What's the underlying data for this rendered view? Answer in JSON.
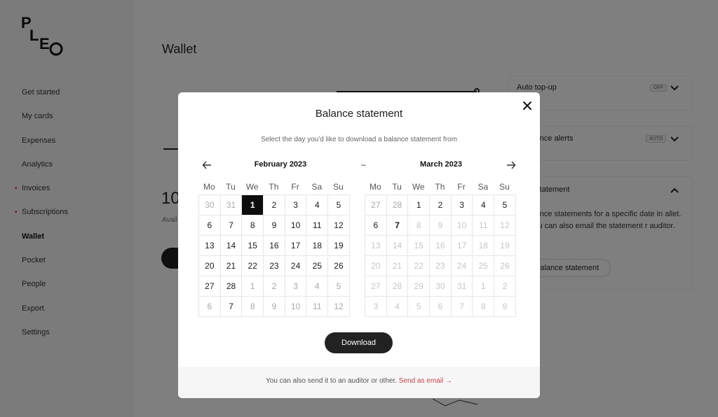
{
  "sidebar": {
    "logo_text": "PLEO",
    "items": [
      {
        "label": "Get started",
        "dot": false,
        "active": false
      },
      {
        "label": "My cards",
        "dot": false,
        "active": false
      },
      {
        "label": "Expenses",
        "dot": false,
        "active": false
      },
      {
        "label": "Analytics",
        "dot": false,
        "active": false
      },
      {
        "label": "Invoices",
        "dot": true,
        "active": false
      },
      {
        "label": "Subscriptions",
        "dot": true,
        "active": false
      },
      {
        "label": "Wallet",
        "dot": false,
        "active": true
      },
      {
        "label": "Pocket",
        "dot": false,
        "active": false
      },
      {
        "label": "People",
        "dot": false,
        "active": false
      },
      {
        "label": "Export",
        "dot": false,
        "active": false
      },
      {
        "label": "Settings",
        "dot": false,
        "active": false
      }
    ]
  },
  "main": {
    "title": "Wallet",
    "balance_partial": "10",
    "available_partial": "Avail"
  },
  "right_panel": {
    "auto_topup": {
      "label": "Auto top-up",
      "badge": "OFF"
    },
    "alerts": {
      "label": "alance alerts",
      "badge": "AUTO"
    },
    "statement": {
      "label": "e statement",
      "text": "alance statements for a specific date in allet. You can also email the statement r auditor.",
      "button": "et balance statement"
    }
  },
  "modal": {
    "title": "Balance statement",
    "subtitle": "Select the day you'd like to download a balance statement from",
    "range_separator": "–",
    "weekdays": [
      "Mo",
      "Tu",
      "We",
      "Th",
      "Fr",
      "Sa",
      "Su"
    ],
    "months": [
      {
        "title": "February 2023",
        "days": [
          [
            "30",
            "muted"
          ],
          [
            "31",
            "muted"
          ],
          [
            "1",
            "selected"
          ],
          [
            "2",
            ""
          ],
          [
            "3",
            ""
          ],
          [
            "4",
            ""
          ],
          [
            "5",
            ""
          ],
          [
            "6",
            ""
          ],
          [
            "7",
            ""
          ],
          [
            "8",
            ""
          ],
          [
            "9",
            ""
          ],
          [
            "10",
            ""
          ],
          [
            "11",
            ""
          ],
          [
            "12",
            ""
          ],
          [
            "13",
            ""
          ],
          [
            "14",
            ""
          ],
          [
            "15",
            ""
          ],
          [
            "16",
            ""
          ],
          [
            "17",
            ""
          ],
          [
            "18",
            ""
          ],
          [
            "19",
            ""
          ],
          [
            "20",
            ""
          ],
          [
            "21",
            ""
          ],
          [
            "22",
            ""
          ],
          [
            "23",
            ""
          ],
          [
            "24",
            ""
          ],
          [
            "25",
            ""
          ],
          [
            "26",
            ""
          ],
          [
            "27",
            ""
          ],
          [
            "28",
            ""
          ],
          [
            "1",
            "muted"
          ],
          [
            "2",
            "muted"
          ],
          [
            "3",
            "muted"
          ],
          [
            "4",
            "muted"
          ],
          [
            "5",
            "muted"
          ],
          [
            "6",
            "muted"
          ],
          [
            "7",
            ""
          ],
          [
            "8",
            "muted"
          ],
          [
            "9",
            "muted"
          ],
          [
            "10",
            "muted"
          ],
          [
            "11",
            "muted"
          ],
          [
            "12",
            "muted"
          ]
        ]
      },
      {
        "title": "March 2023",
        "days": [
          [
            "27",
            "muted"
          ],
          [
            "28",
            "muted"
          ],
          [
            "1",
            ""
          ],
          [
            "2",
            ""
          ],
          [
            "3",
            ""
          ],
          [
            "4",
            ""
          ],
          [
            "5",
            ""
          ],
          [
            "6",
            ""
          ],
          [
            "7",
            "strong"
          ],
          [
            "8",
            "disabled"
          ],
          [
            "9",
            "disabled"
          ],
          [
            "10",
            "disabled"
          ],
          [
            "11",
            "disabled"
          ],
          [
            "12",
            "disabled"
          ],
          [
            "13",
            "disabled"
          ],
          [
            "14",
            "disabled"
          ],
          [
            "15",
            "disabled"
          ],
          [
            "16",
            "disabled"
          ],
          [
            "17",
            "disabled"
          ],
          [
            "18",
            "disabled"
          ],
          [
            "19",
            "disabled"
          ],
          [
            "20",
            "disabled"
          ],
          [
            "21",
            "disabled"
          ],
          [
            "22",
            "disabled"
          ],
          [
            "23",
            "disabled"
          ],
          [
            "24",
            "disabled"
          ],
          [
            "25",
            "disabled"
          ],
          [
            "26",
            "disabled"
          ],
          [
            "27",
            "disabled"
          ],
          [
            "28",
            "disabled"
          ],
          [
            "29",
            "disabled"
          ],
          [
            "30",
            "disabled"
          ],
          [
            "31",
            "disabled"
          ],
          [
            "1",
            "disabled"
          ],
          [
            "2",
            "disabled"
          ],
          [
            "3",
            "disabled"
          ],
          [
            "4",
            "disabled"
          ],
          [
            "5",
            "disabled"
          ],
          [
            "6",
            "disabled"
          ],
          [
            "7",
            "disabled"
          ],
          [
            "8",
            "disabled"
          ],
          [
            "9",
            "disabled"
          ]
        ]
      }
    ],
    "download_label": "Download",
    "footer_text": "You can also send it to an auditor or other.",
    "footer_link": "Send as email →"
  },
  "colors": {
    "accent_link": "#c2424a",
    "selected_day": "#0d0d0d",
    "nav_dot": "#dd2233"
  }
}
